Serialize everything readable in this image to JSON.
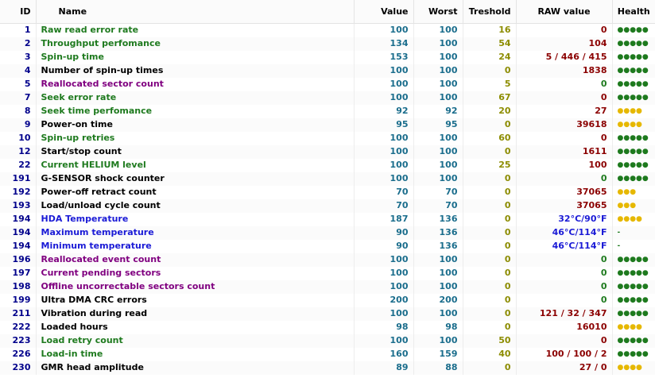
{
  "columns": {
    "id": "ID",
    "name": "Name",
    "value": "Value",
    "worst": "Worst",
    "treshold": "Treshold",
    "raw": "RAW value",
    "health": "Health"
  },
  "colors": {
    "green_name": "#1e7a1e",
    "purple_name": "#800080",
    "blue_name": "#1a1ad6",
    "black_name": "#000000",
    "raw_red": "#8b0000",
    "raw_green": "#1e7a1e",
    "raw_blue": "#1a1ad6",
    "health_green": "#1e7a1e",
    "health_yellow": "#e6b800"
  },
  "rows": [
    {
      "id": "1",
      "name": "Raw read error rate",
      "name_color": "green",
      "value": "100",
      "worst": "100",
      "treshold": "16",
      "raw": "0",
      "raw_color": "red",
      "health": "●●●●●",
      "health_color": "green"
    },
    {
      "id": "2",
      "name": "Throughput perfomance",
      "name_color": "green",
      "value": "134",
      "worst": "100",
      "treshold": "54",
      "raw": "104",
      "raw_color": "red",
      "health": "●●●●●",
      "health_color": "green"
    },
    {
      "id": "3",
      "name": "Spin-up time",
      "name_color": "green",
      "value": "153",
      "worst": "100",
      "treshold": "24",
      "raw": "5 / 446 / 415",
      "raw_color": "red",
      "health": "●●●●●",
      "health_color": "green"
    },
    {
      "id": "4",
      "name": "Number of spin-up times",
      "name_color": "black",
      "value": "100",
      "worst": "100",
      "treshold": "0",
      "raw": "1838",
      "raw_color": "red",
      "health": "●●●●●",
      "health_color": "green"
    },
    {
      "id": "5",
      "name": "Reallocated sector count",
      "name_color": "purple",
      "value": "100",
      "worst": "100",
      "treshold": "5",
      "raw": "0",
      "raw_color": "green",
      "health": "●●●●●",
      "health_color": "green"
    },
    {
      "id": "7",
      "name": "Seek error rate",
      "name_color": "green",
      "value": "100",
      "worst": "100",
      "treshold": "67",
      "raw": "0",
      "raw_color": "red",
      "health": "●●●●●",
      "health_color": "green"
    },
    {
      "id": "8",
      "name": "Seek time perfomance",
      "name_color": "green",
      "value": "92",
      "worst": "92",
      "treshold": "20",
      "raw": "27",
      "raw_color": "red",
      "health": "●●●●",
      "health_color": "yellow"
    },
    {
      "id": "9",
      "name": "Power-on time",
      "name_color": "black",
      "value": "95",
      "worst": "95",
      "treshold": "0",
      "raw": "39618",
      "raw_color": "red",
      "health": "●●●●",
      "health_color": "yellow"
    },
    {
      "id": "10",
      "name": "Spin-up retries",
      "name_color": "green",
      "value": "100",
      "worst": "100",
      "treshold": "60",
      "raw": "0",
      "raw_color": "red",
      "health": "●●●●●",
      "health_color": "green"
    },
    {
      "id": "12",
      "name": "Start/stop count",
      "name_color": "black",
      "value": "100",
      "worst": "100",
      "treshold": "0",
      "raw": "1611",
      "raw_color": "red",
      "health": "●●●●●",
      "health_color": "green"
    },
    {
      "id": "22",
      "name": "Current HELIUM level",
      "name_color": "green",
      "value": "100",
      "worst": "100",
      "treshold": "25",
      "raw": "100",
      "raw_color": "red",
      "health": "●●●●●",
      "health_color": "green"
    },
    {
      "id": "191",
      "name": "G-SENSOR shock counter",
      "name_color": "black",
      "value": "100",
      "worst": "100",
      "treshold": "0",
      "raw": "0",
      "raw_color": "green",
      "health": "●●●●●",
      "health_color": "green"
    },
    {
      "id": "192",
      "name": "Power-off retract count",
      "name_color": "black",
      "value": "70",
      "worst": "70",
      "treshold": "0",
      "raw": "37065",
      "raw_color": "red",
      "health": "●●●",
      "health_color": "yellow"
    },
    {
      "id": "193",
      "name": "Load/unload cycle count",
      "name_color": "black",
      "value": "70",
      "worst": "70",
      "treshold": "0",
      "raw": "37065",
      "raw_color": "red",
      "health": "●●●",
      "health_color": "yellow"
    },
    {
      "id": "194",
      "name": "HDA Temperature",
      "name_color": "blue",
      "value": "187",
      "worst": "136",
      "treshold": "0",
      "raw": "32°C/90°F",
      "raw_color": "blue",
      "health": "●●●●",
      "health_color": "yellow"
    },
    {
      "id": "194",
      "name": "Maximum temperature",
      "name_color": "blue",
      "value": "90",
      "worst": "136",
      "treshold": "0",
      "raw": "46°C/114°F",
      "raw_color": "blue",
      "health": "-",
      "health_color": "green"
    },
    {
      "id": "194",
      "name": "Minimum temperature",
      "name_color": "blue",
      "value": "90",
      "worst": "136",
      "treshold": "0",
      "raw": "46°C/114°F",
      "raw_color": "blue",
      "health": "-",
      "health_color": "green"
    },
    {
      "id": "196",
      "name": "Reallocated event count",
      "name_color": "purple",
      "value": "100",
      "worst": "100",
      "treshold": "0",
      "raw": "0",
      "raw_color": "green",
      "health": "●●●●●",
      "health_color": "green"
    },
    {
      "id": "197",
      "name": "Current pending sectors",
      "name_color": "purple",
      "value": "100",
      "worst": "100",
      "treshold": "0",
      "raw": "0",
      "raw_color": "green",
      "health": "●●●●●",
      "health_color": "green"
    },
    {
      "id": "198",
      "name": "Offline uncorrectable sectors count",
      "name_color": "purple",
      "value": "100",
      "worst": "100",
      "treshold": "0",
      "raw": "0",
      "raw_color": "green",
      "health": "●●●●●",
      "health_color": "green"
    },
    {
      "id": "199",
      "name": "Ultra DMA CRC errors",
      "name_color": "black",
      "value": "200",
      "worst": "200",
      "treshold": "0",
      "raw": "0",
      "raw_color": "green",
      "health": "●●●●●",
      "health_color": "green"
    },
    {
      "id": "211",
      "name": "Vibration during read",
      "name_color": "black",
      "value": "100",
      "worst": "100",
      "treshold": "0",
      "raw": "121 / 32 / 347",
      "raw_color": "red",
      "health": "●●●●●",
      "health_color": "green"
    },
    {
      "id": "222",
      "name": "Loaded hours",
      "name_color": "black",
      "value": "98",
      "worst": "98",
      "treshold": "0",
      "raw": "16010",
      "raw_color": "red",
      "health": "●●●●",
      "health_color": "yellow"
    },
    {
      "id": "223",
      "name": "Load retry count",
      "name_color": "green",
      "value": "100",
      "worst": "100",
      "treshold": "50",
      "raw": "0",
      "raw_color": "red",
      "health": "●●●●●",
      "health_color": "green"
    },
    {
      "id": "226",
      "name": "Load-in time",
      "name_color": "green",
      "value": "160",
      "worst": "159",
      "treshold": "40",
      "raw": "100 / 100 / 2",
      "raw_color": "red",
      "health": "●●●●●",
      "health_color": "green"
    },
    {
      "id": "230",
      "name": "GMR head amplitude",
      "name_color": "black",
      "value": "89",
      "worst": "88",
      "treshold": "0",
      "raw": "27 / 0",
      "raw_color": "red",
      "health": "●●●●",
      "health_color": "yellow"
    }
  ]
}
